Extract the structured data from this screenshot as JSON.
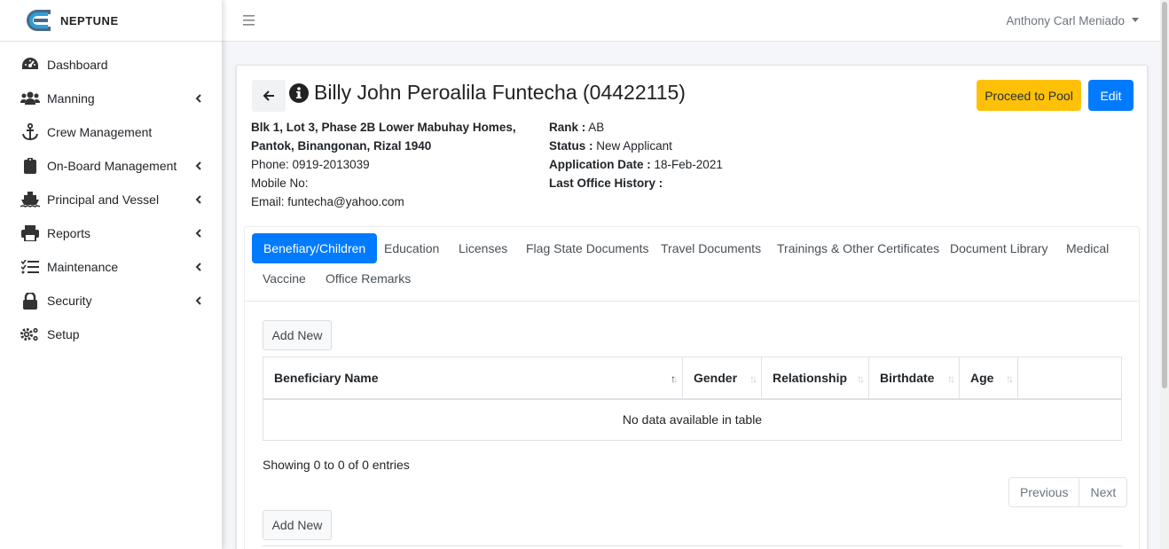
{
  "brand": {
    "name": "NEPTUNE"
  },
  "sidebar": {
    "items": [
      {
        "label": "Dashboard",
        "icon": "tachometer-icon",
        "has_submenu": false
      },
      {
        "label": "Manning",
        "icon": "users-icon",
        "has_submenu": true
      },
      {
        "label": "Crew Management",
        "icon": "anchor-icon",
        "has_submenu": false
      },
      {
        "label": "On-Board Management",
        "icon": "clipboard-icon",
        "has_submenu": true
      },
      {
        "label": "Principal and Vessel",
        "icon": "ship-icon",
        "has_submenu": true
      },
      {
        "label": "Reports",
        "icon": "printer-icon",
        "has_submenu": true
      },
      {
        "label": "Maintenance",
        "icon": "list-check-icon",
        "has_submenu": true
      },
      {
        "label": "Security",
        "icon": "lock-icon",
        "has_submenu": true
      },
      {
        "label": "Setup",
        "icon": "gears-icon",
        "has_submenu": false
      }
    ]
  },
  "topbar": {
    "user_name": "Anthony Carl Meniado"
  },
  "crew": {
    "title": "Billy John Peroalila Funtecha (04422115)",
    "address_line1": "Blk 1, Lot 3, Phase 2B Lower Mabuhay Homes,",
    "address_line2": "Pantok, Binangonan, Rizal 1940",
    "phone": "Phone: 0919-2013039",
    "mobile": "Mobile No:",
    "email": "Email: funtecha@yahoo.com",
    "rank_label": "Rank :",
    "rank_value": "AB",
    "status_label": "Status :",
    "status_value": "New Applicant",
    "app_date_label": "Application Date :",
    "app_date_value": "18-Feb-2021",
    "last_office_label": "Last Office History :",
    "last_office_value": ""
  },
  "actions": {
    "proceed_label": "Proceed to Pool",
    "edit_label": "Edit"
  },
  "tabs": [
    "Benefiary/Children",
    "Education",
    "Licenses",
    "Flag State Documents",
    "Travel Documents",
    "Trainings & Other Certificates",
    "Document Library",
    "Medical",
    "Vaccine",
    "Office Remarks"
  ],
  "active_tab": "Benefiary/Children",
  "table": {
    "add_label": "Add New",
    "columns": [
      "Beneficiary Name",
      "Gender",
      "Relationship",
      "Birthdate",
      "Age",
      ""
    ],
    "sorted_column": "Beneficiary Name",
    "empty_text": "No data available in table",
    "info": "Showing 0 to 0 of 0 entries",
    "prev_label": "Previous",
    "next_label": "Next"
  },
  "colors": {
    "primary": "#007bff",
    "warning": "#ffc107"
  }
}
